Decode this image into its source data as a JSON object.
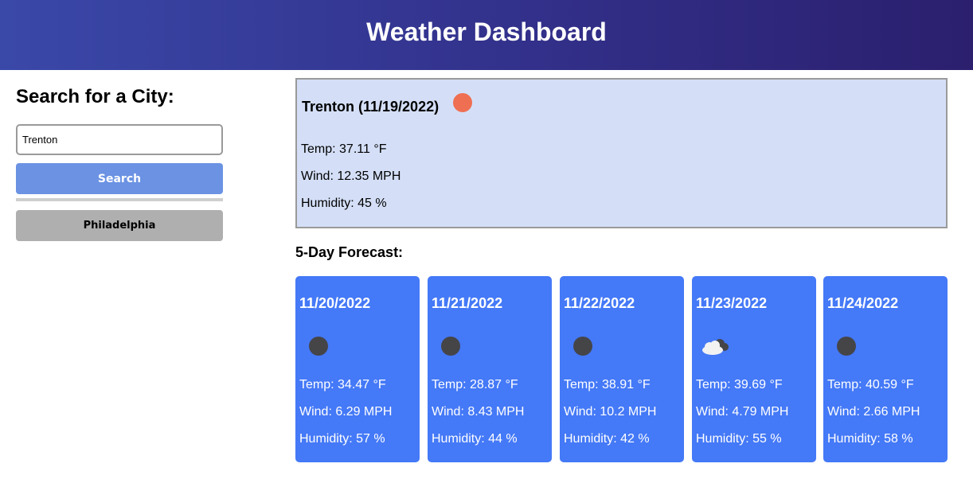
{
  "header": {
    "title": "Weather Dashboard"
  },
  "sidebar": {
    "heading": "Search for a City:",
    "search_value": "Trenton",
    "search_button": "Search",
    "history": [
      "Philadelphia"
    ]
  },
  "current": {
    "city_date": "Trenton (11/19/2022)",
    "icon": "sun-icon",
    "icon_color": "#ef6f52",
    "temp": "Temp: 37.11 °F",
    "wind": "Wind: 12.35 MPH",
    "humidity": "Humidity: 45 %"
  },
  "forecast": {
    "title": "5-Day Forecast:",
    "days": [
      {
        "date": "11/20/2022",
        "icon": "moon-icon",
        "temp": "Temp: 34.47 °F",
        "wind": "Wind: 6.29 MPH",
        "humidity": "Humidity: 57 %"
      },
      {
        "date": "11/21/2022",
        "icon": "moon-icon",
        "temp": "Temp: 28.87 °F",
        "wind": "Wind: 8.43 MPH",
        "humidity": "Humidity: 44 %"
      },
      {
        "date": "11/22/2022",
        "icon": "moon-icon",
        "temp": "Temp: 38.91 °F",
        "wind": "Wind: 10.2 MPH",
        "humidity": "Humidity: 42 %"
      },
      {
        "date": "11/23/2022",
        "icon": "cloud-night-icon",
        "temp": "Temp: 39.69 °F",
        "wind": "Wind: 4.79 MPH",
        "humidity": "Humidity: 55 %"
      },
      {
        "date": "11/24/2022",
        "icon": "moon-icon",
        "temp": "Temp: 40.59 °F",
        "wind": "Wind: 2.66 MPH",
        "humidity": "Humidity: 58 %"
      }
    ]
  },
  "colors": {
    "header_gradient_start": "#3a48a8",
    "header_gradient_end": "#2b1f6e",
    "current_bg": "#d4dff7",
    "card_bg": "#4479f7",
    "search_button_bg": "#6b92e3",
    "history_button_bg": "#afafaf"
  }
}
